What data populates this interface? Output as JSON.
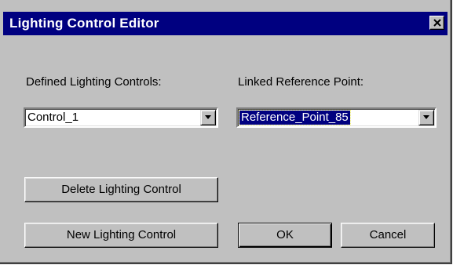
{
  "window": {
    "title": "Lighting Control Editor",
    "close_glyph": "close-icon"
  },
  "controls": {
    "label": "Defined Lighting Controls:",
    "selected": "Control_1"
  },
  "reference": {
    "label": "Linked Reference Point:",
    "selected": "Reference_Point_85"
  },
  "buttons": {
    "delete_label": "Delete Lighting Control",
    "new_label": "New Lighting Control",
    "ok_label": "OK",
    "cancel_label": "Cancel"
  },
  "colors": {
    "titlebar": "#000080",
    "face": "#c0c0c0",
    "selection": "#000080"
  }
}
